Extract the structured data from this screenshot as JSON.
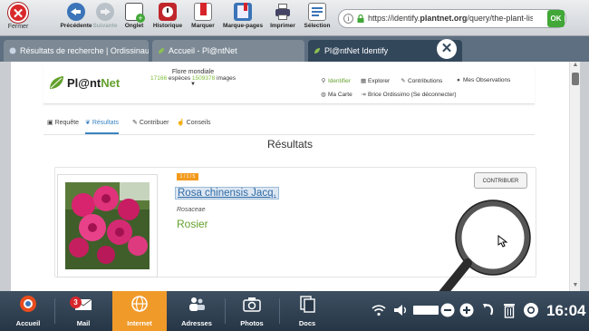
{
  "toolbar": {
    "close_label": "Fermer",
    "buttons": [
      {
        "label": "Précédente",
        "disabled": false
      },
      {
        "label": "Suivante",
        "disabled": true
      },
      {
        "label": "Onglet",
        "disabled": false
      },
      {
        "label": "Historique",
        "disabled": false
      },
      {
        "label": "Marquer",
        "disabled": false
      },
      {
        "label": "Marque-pages",
        "disabled": false
      },
      {
        "label": "Imprimer",
        "disabled": false
      },
      {
        "label": "Sélection",
        "disabled": false
      }
    ],
    "url_prefix": "https://identify.",
    "url_domain": "plantnet.org",
    "url_suffix": "/query/the-plant-list/?viewer",
    "go_label": "OK"
  },
  "tabs": [
    {
      "label": "Résultats de recherche | Ordissinaute",
      "active": false
    },
    {
      "label": "Accueil - Pl@ntNet",
      "active": false
    },
    {
      "label": "Pl@ntNet Identify",
      "active": true
    }
  ],
  "site": {
    "logo_part1": "Pl@nt",
    "logo_part2": "Net",
    "flora_title": "Flore mondiale",
    "flora_species_count": "17166",
    "flora_species_label": "espèces",
    "flora_images_count": "1509378",
    "flora_images_label": "images",
    "nav": {
      "identifier": "Identifier",
      "explorer": "Explorer",
      "contributions": "Contributions",
      "observations": "Mes Observations",
      "map": "Ma Carte",
      "user": "Brice Ordissimo (Se déconnecter)"
    },
    "page_tabs": [
      "Requête",
      "Résultats",
      "Contribuer",
      "Conseils"
    ],
    "results_title": "Résultats"
  },
  "result": {
    "rank_badge": "1 / 1 / 5",
    "scientific_name": "Rosa chinensis Jacq.",
    "family": "Rosaceae",
    "common_name": "Rosier",
    "contribute_label": "CONTRIBUER"
  },
  "dock": {
    "items": [
      "Accueil",
      "Mail",
      "Internet",
      "Adresses",
      "Photos",
      "Docs"
    ],
    "mail_count": "3",
    "active": "Internet",
    "clock": "16:04"
  },
  "colors": {
    "plantnet_green": "#64a12d",
    "active_dock": "#f09a2a",
    "link_blue": "#2e6aa6",
    "tab_active": "#33475b"
  }
}
